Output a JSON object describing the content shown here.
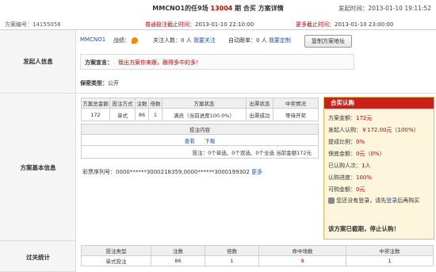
{
  "header": {
    "title_prefix": "MMCNO1的",
    "title_game": "任9场",
    "title_issue": "13004",
    "title_suffix": "期 合买 方案详情",
    "launch_time_label": "发起时间：",
    "launch_time": "2013-01-10 19:11:52",
    "scheme_code_label": "方案编号：",
    "scheme_code": "14155058",
    "normal_deadline_label": "普通投注截止时间：",
    "normal_deadline": "2013-01-10 22:10:00",
    "more_deadline_label": "更多截止时间：",
    "more_deadline": "2013-01-10 23:00:00"
  },
  "initiator": {
    "section_label": "发起人信息",
    "username": "MMCNO1",
    "record_label": "战绩：",
    "record_icon": "flame-icon",
    "followers_label": "关注人数：",
    "followers_count": "0",
    "followers_unit": "人",
    "follow_link": "我要关注",
    "auto_follow_label": "自动跟单：",
    "auto_follow_count": "0",
    "auto_follow_unit": "人",
    "customize_link": "我要定制",
    "copy_button": "复制方案地址",
    "declare_label": "方案宣言：",
    "declare_text": "我出方案你来跟，跟得多中的多！",
    "secrecy_label": "保密类型：",
    "secrecy_value": "公开"
  },
  "basic": {
    "section_label": "方案基本信息",
    "columns": [
      "方案总金额",
      "投注方式",
      "注数",
      "倍数",
      "方案状态",
      "出票状态",
      "中奖情况"
    ],
    "row": [
      "172",
      "单式",
      "86",
      "1",
      "满员（当前进度100.0%）",
      "出票成功",
      "等待开奖"
    ],
    "content_header": "投注内容",
    "view_link": "查看",
    "download_link": "下载",
    "summary": "投注：0个单选、0个双选、0个全选 当前金额172元",
    "ticket_label": "彩票序列号：",
    "ticket_value": "0000******3000218359,0000******3000199302",
    "more_link": "更多"
  },
  "buy_panel": {
    "title": "合买认购",
    "total_label": "方案金额：",
    "total_value": "172元",
    "initiator_label": "发起人认购：",
    "initiator_value": "￥172.00元（100%）",
    "commission_label": "提成比例：",
    "commission_value": "0%",
    "guarantee_label": "保底金额：",
    "guarantee_value": "0元（0%）",
    "subscribers_label": "已认购人次：",
    "subscribers_value": "1人",
    "progress_label": "认购进度：",
    "progress_value": "100%",
    "available_label": "可购金额：",
    "available_value": "0元",
    "login_prefix": "您还没有登录，请先",
    "login_link": "登录",
    "login_suffix": "后再购买",
    "closed_notice": "该方案已截期，停止认购！"
  },
  "pass_stats": {
    "section_label": "过关统计",
    "columns": [
      "投注类型",
      "注数",
      "倍数",
      "命中场数",
      "中奖注数"
    ],
    "row": [
      "单式投注",
      "86",
      "1",
      "9",
      "1"
    ]
  }
}
